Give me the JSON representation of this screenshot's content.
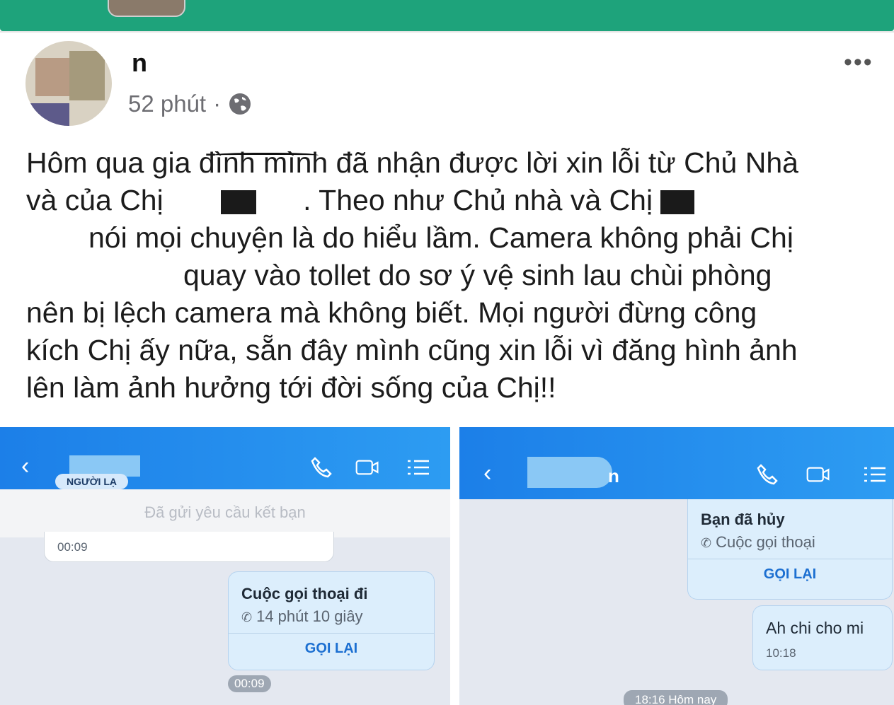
{
  "post": {
    "author": "n",
    "time": "52 phút",
    "separator": "·",
    "text_lines": [
      "Hôm qua gia đình mình đã nhận được lời xin lỗi từ Chủ Nhà",
      "và của Chị",
      ". Theo như Chủ nhà và Chị",
      "nói mọi chuyện là do hiểu lầm. Camera không phải Chị",
      "quay vào tollet do sơ ý vệ sinh lau chùi phòng",
      "nên bị lệch camera mà không biết. Mọi người đừng công",
      "kích Chị ấy nữa, sẵn đây mình cũng xin lỗi vì đăng hình ảnh",
      "lên làm ảnh hưởng tới đời sống của Chị!!"
    ]
  },
  "left_shot": {
    "badge": "NGƯỜI LẠ",
    "request": "Đã gửi yêu cầu kết bạn",
    "top_time": "00:09",
    "call": {
      "title": "Cuộc gọi thoại đi",
      "duration": "14 phút 10 giây",
      "action": "GỌI LẠI"
    },
    "chip_time": "00:09"
  },
  "right_shot": {
    "name": "n",
    "call": {
      "title": "Bạn đã hủy",
      "subtitle": "Cuộc gọi thoại",
      "action": "GỌI LẠI"
    },
    "message": {
      "text": "Ah chi cho mi",
      "time": "10:18"
    },
    "chip_time": "18:16 Hôm nay"
  },
  "colors": {
    "top_bar": "#1ea37b",
    "header_blue": "#1c7fe8",
    "link_blue": "#1c6fd1"
  },
  "icons": [
    "globe-icon",
    "more-icon",
    "back-icon",
    "phone-icon",
    "video-icon",
    "list-icon"
  ]
}
